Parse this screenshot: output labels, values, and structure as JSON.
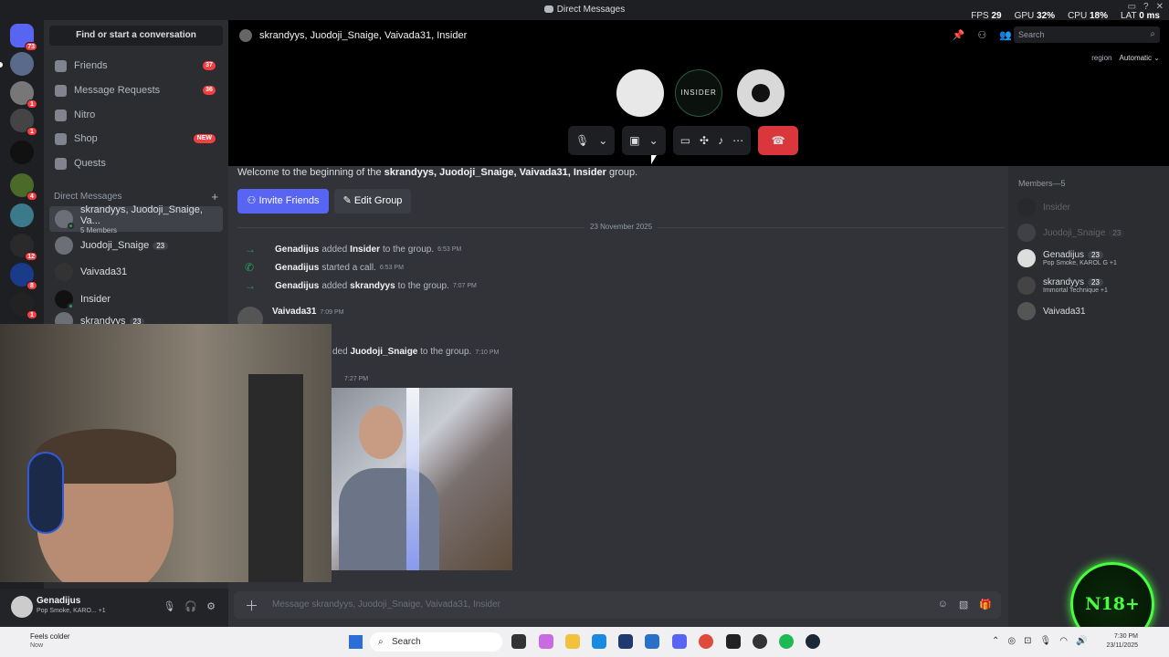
{
  "window": {
    "title": "Direct Messages",
    "stats": {
      "fps_label": "FPS",
      "fps": "29",
      "gpu_label": "GPU",
      "gpu": "32%",
      "cpu_label": "CPU",
      "cpu": "18%",
      "lat_label": "LAT",
      "lat": "0 ms"
    }
  },
  "servers": [
    {
      "badge": "73"
    },
    {
      "badge": ""
    },
    {
      "badge": "1"
    },
    {
      "badge": "1"
    },
    {
      "badge": ""
    },
    {
      "badge": "4"
    },
    {
      "badge": ""
    },
    {
      "badge": "12"
    },
    {
      "badge": "8"
    },
    {
      "badge": "1"
    }
  ],
  "sidebar": {
    "find": "Find or start a conversation",
    "nav": [
      {
        "label": "Friends",
        "count": "37"
      },
      {
        "label": "Message Requests",
        "count": "36"
      },
      {
        "label": "Nitro",
        "count": ""
      },
      {
        "label": "Shop",
        "count": "NEW"
      },
      {
        "label": "Quests",
        "count": ""
      }
    ],
    "dm_header": "Direct Messages",
    "dms": [
      {
        "name": "skrandyys, Juodoji_Snaige, Va...",
        "sub": "5 Members"
      },
      {
        "name": "Juodoji_Snaige",
        "badge": "23"
      },
      {
        "name": "Vaivada31"
      },
      {
        "name": "Insider"
      },
      {
        "name": "skrandyys",
        "badge": "23"
      }
    ]
  },
  "user": {
    "name": "Genadijus",
    "activity": "Pop Smoke, KARO...",
    "extra": "+1"
  },
  "call": {
    "title": "skrandyys, Juodoji_Snaige, Vaivada31, Insider",
    "search_placeholder": "Search",
    "region_label": "region",
    "region_value": "Automatic",
    "insider_tile": "INSIDER"
  },
  "chat": {
    "welcome_pre": "Welcome to the beginning of the ",
    "welcome_group": "skrandyys, Juodoji_Snaige, Vaivada31, Insider",
    "welcome_post": " group.",
    "invite_btn": "Invite Friends",
    "edit_btn": "Edit Group",
    "date": "23 November 2025",
    "system": [
      {
        "actor": "Genadijus",
        "verb": "added",
        "target": "Insider",
        "tail": "to the group.",
        "time": "6:53 PM"
      },
      {
        "actor": "Genadijus",
        "verb": "started a call.",
        "target": "",
        "tail": "",
        "time": "6:53 PM"
      },
      {
        "actor": "Genadijus",
        "verb": "added",
        "target": "skrandyys",
        "tail": "to the group.",
        "time": "7:07 PM"
      }
    ],
    "msg1": {
      "author": "Vaivada31",
      "time": "7:09 PM"
    },
    "sys_partial": {
      "verb": "ded",
      "target": "Juodoji_Snaige",
      "tail": "to the group.",
      "time": "7:10 PM"
    },
    "time_partial": "7:27 PM",
    "composer_placeholder": "Message skrandyys, Juodoji_Snaige, Vaivada31, Insider"
  },
  "members": {
    "header": "Members—5",
    "list": [
      {
        "name": "Insider",
        "activity": "",
        "dim": true
      },
      {
        "name": "Juodoji_Snaige",
        "activity": "",
        "dim": true,
        "badge": "23"
      },
      {
        "name": "Genadijus",
        "activity": "Pop Smoke, KAROL G +1",
        "badge": "23"
      },
      {
        "name": "skrandyys",
        "activity": "Immortal Technique +1",
        "badge": "23"
      },
      {
        "name": "Vaivada31",
        "activity": ""
      }
    ]
  },
  "taskbar": {
    "weather_title": "Feels colder",
    "weather_sub": "Now",
    "search": "Search",
    "time": "7:30 PM",
    "date": "23/11/2025"
  },
  "overlay_badge": "N18+",
  "colors": {
    "accent": "#5865f2",
    "danger": "#da373c",
    "online": "#23a55a"
  }
}
